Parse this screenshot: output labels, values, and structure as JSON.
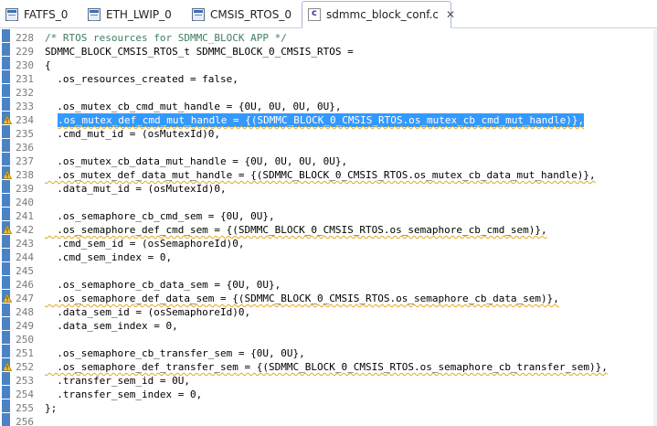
{
  "tabs": [
    {
      "label": "FATFS_0",
      "icon": "component-icon"
    },
    {
      "label": "ETH_LWIP_0",
      "icon": "component-icon"
    },
    {
      "label": "CMSIS_RTOS_0",
      "icon": "component-icon"
    },
    {
      "label": "sdmmc_block_conf.c",
      "icon": "c-file-icon",
      "icon_letter": "c",
      "active": true,
      "close_label": "✕"
    }
  ],
  "editor": {
    "lines": [
      {
        "num": "228",
        "text": "/* RTOS resources for SDMMC_BLOCK APP */",
        "type": "comment"
      },
      {
        "num": "229",
        "text": "SDMMC_BLOCK_CMSIS_RTOS_t SDMMC_BLOCK_0_CMSIS_RTOS ="
      },
      {
        "num": "230",
        "text": "{"
      },
      {
        "num": "231",
        "text": "  .os_resources_created = false,"
      },
      {
        "num": "232",
        "text": ""
      },
      {
        "num": "233",
        "text": "  .os_mutex_cb_cmd_mut_handle = {0U, 0U, 0U, 0U},"
      },
      {
        "num": "234",
        "text": "  .os_mutex_def_cmd_mut_handle = {(SDMMC_BLOCK_0_CMSIS_RTOS.os_mutex_cb_cmd_mut_handle)},",
        "warning": true,
        "selected": true
      },
      {
        "num": "235",
        "text": "  .cmd_mut_id = (osMutexId)0,"
      },
      {
        "num": "236",
        "text": ""
      },
      {
        "num": "237",
        "text": "  .os_mutex_cb_data_mut_handle = {0U, 0U, 0U, 0U},"
      },
      {
        "num": "238",
        "text": "  .os_mutex_def_data_mut_handle = {(SDMMC_BLOCK_0_CMSIS_RTOS.os_mutex_cb_data_mut_handle)},",
        "warning": true
      },
      {
        "num": "239",
        "text": "  .data_mut_id = (osMutexId)0,"
      },
      {
        "num": "240",
        "text": ""
      },
      {
        "num": "241",
        "text": "  .os_semaphore_cb_cmd_sem = {0U, 0U},"
      },
      {
        "num": "242",
        "text": "  .os_semaphore_def_cmd_sem = {(SDMMC_BLOCK_0_CMSIS_RTOS.os_semaphore_cb_cmd_sem)},",
        "warning": true
      },
      {
        "num": "243",
        "text": "  .cmd_sem_id = (osSemaphoreId)0,"
      },
      {
        "num": "244",
        "text": "  .cmd_sem_index = 0,"
      },
      {
        "num": "245",
        "text": ""
      },
      {
        "num": "246",
        "text": "  .os_semaphore_cb_data_sem = {0U, 0U},"
      },
      {
        "num": "247",
        "text": "  .os_semaphore_def_data_sem = {(SDMMC_BLOCK_0_CMSIS_RTOS.os_semaphore_cb_data_sem)},",
        "warning": true
      },
      {
        "num": "248",
        "text": "  .data_sem_id = (osSemaphoreId)0,"
      },
      {
        "num": "249",
        "text": "  .data_sem_index = 0,"
      },
      {
        "num": "250",
        "text": ""
      },
      {
        "num": "251",
        "text": "  .os_semaphore_cb_transfer_sem = {0U, 0U},"
      },
      {
        "num": "252",
        "text": "  .os_semaphore_def_transfer_sem = {(SDMMC_BLOCK_0_CMSIS_RTOS.os_semaphore_cb_transfer_sem)},",
        "warning": true
      },
      {
        "num": "253",
        "text": "  .transfer_sem_id = 0U,"
      },
      {
        "num": "254",
        "text": "  .transfer_sem_index = 0,"
      },
      {
        "num": "255",
        "text": "};"
      },
      {
        "num": "256",
        "text": ""
      }
    ]
  },
  "colors": {
    "selection": "#3399ff",
    "comment": "#3f7f5f",
    "warning_underline": "#e2a822",
    "ruler": "#4a83c5"
  }
}
